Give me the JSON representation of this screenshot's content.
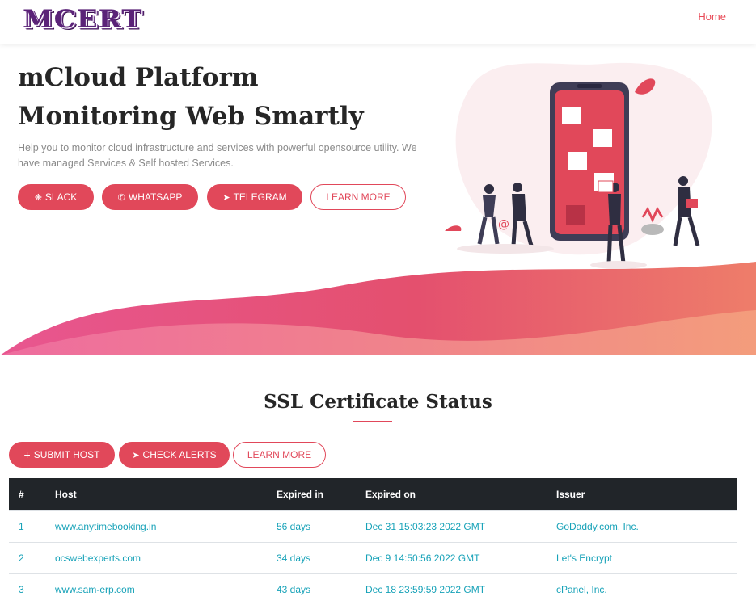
{
  "navbar": {
    "logo_text": "MCERT",
    "home_link": "Home"
  },
  "hero": {
    "title_line1": "mCloud Platform",
    "title_line2": "Monitoring Web Smartly",
    "description": "Help you to monitor cloud infrastructure and services with powerful opensource utility. We have managed Services & Self hosted Services.",
    "buttons": {
      "slack": "SLACK",
      "whatsapp": "WHATSAPP",
      "telegram": "TELEGRAM",
      "learn_more": "LEARN MORE"
    }
  },
  "section": {
    "title": "SSL Certificate Status",
    "buttons": {
      "submit_host": "SUBMIT HOST",
      "check_alerts": "CHECK ALERTS",
      "learn_more": "LEARN MORE"
    }
  },
  "table": {
    "headers": {
      "num": "#",
      "host": "Host",
      "expired_in": "Expired in",
      "expired_on": "Expired on",
      "issuer": "Issuer"
    },
    "rows": [
      {
        "num": "1",
        "host": "www.anytimebooking.in",
        "expired_in": "56 days",
        "expired_on": "Dec 31 15:03:23 2022 GMT",
        "issuer": "GoDaddy.com, Inc."
      },
      {
        "num": "2",
        "host": "ocswebexperts.com",
        "expired_in": "34 days",
        "expired_on": "Dec 9 14:50:56 2022 GMT",
        "issuer": "Let's Encrypt"
      },
      {
        "num": "3",
        "host": "www.sam-erp.com",
        "expired_in": "43 days",
        "expired_on": "Dec 18 23:59:59 2022 GMT",
        "issuer": "cPanel, Inc."
      }
    ]
  },
  "icons": {
    "slack": "slack-icon",
    "whatsapp": "whatsapp-icon",
    "telegram": "telegram-icon",
    "plus": "plus-icon",
    "send": "send-icon"
  },
  "colors": {
    "accent": "#e1485a",
    "table_header": "#212529",
    "link": "#17a2b8",
    "wave_start": "#e85690",
    "wave_end": "#f29a78"
  }
}
